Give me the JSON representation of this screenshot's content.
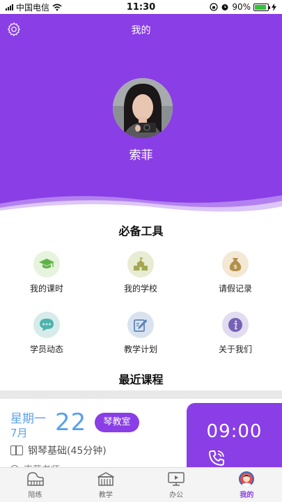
{
  "status_bar": {
    "carrier": "中国电信",
    "time": "11:30",
    "battery_text": "90%",
    "battery_level": 0.9,
    "signal_icon": "signal-icon",
    "wifi_icon": "wifi-icon",
    "alarm_icon": "alarm-icon",
    "lock_icon": "rotation-lock-icon",
    "charging_icon": "charging-icon"
  },
  "header": {
    "title": "我的",
    "settings_icon": "gear-icon",
    "username": "索菲",
    "background_color": "#8a3ee6"
  },
  "tools": {
    "title": "必备工具",
    "items": [
      {
        "label": "我的课时",
        "icon": "graduation-cap-icon",
        "bg": "#e6f3dd",
        "fg": "#5fb24a"
      },
      {
        "label": "我的学校",
        "icon": "school-building-icon",
        "bg": "#e8ecd3",
        "fg": "#a5a853"
      },
      {
        "label": "请假记录",
        "icon": "money-bag-icon",
        "bg": "#f2e8d3",
        "fg": "#b28f4b"
      },
      {
        "label": "学员动态",
        "icon": "chat-bubble-icon",
        "bg": "#d6eceb",
        "fg": "#4db3ab"
      },
      {
        "label": "教学计划",
        "icon": "edit-note-icon",
        "bg": "#d9e3f0",
        "fg": "#5d85b8"
      },
      {
        "label": "关于我们",
        "icon": "info-icon",
        "bg": "#e1dcef",
        "fg": "#7662b5"
      }
    ]
  },
  "recent": {
    "title": "最近课程",
    "weekday": "星期一",
    "month": "7月",
    "day": "22",
    "room": "琴教室",
    "course": "钢琴基础(45分钟)",
    "teacher": "索菲老师",
    "time": "09:00",
    "phone_icon": "phone-call-icon"
  },
  "tabbar": {
    "items": [
      {
        "label": "陪练",
        "icon": "piano-icon"
      },
      {
        "label": "教学",
        "icon": "school-icon"
      },
      {
        "label": "办公",
        "icon": "monitor-icon"
      },
      {
        "label": "我的",
        "icon": "user-avatar-icon",
        "active": true
      }
    ],
    "accent": "#8a3ee6"
  }
}
